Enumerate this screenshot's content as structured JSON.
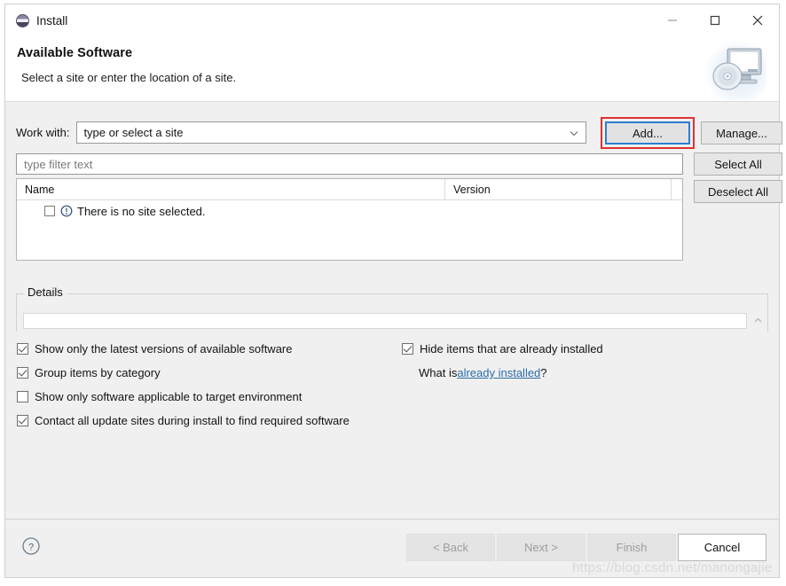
{
  "window": {
    "title": "Install",
    "app_icon": "eclipse-install-icon",
    "controls": {
      "minimize": "minimize-icon",
      "maximize": "maximize-icon",
      "close": "close-icon"
    }
  },
  "header": {
    "title": "Available Software",
    "subtitle": "Select a site or enter the location of a site.",
    "graphic": "computer-cd-icon"
  },
  "work_with": {
    "label": "Work with:",
    "value": "type or select a site",
    "dropdown_icon": "chevron-down-icon",
    "add_button": "Add...",
    "manage_button": "Manage...",
    "highlight_color": "#e03131",
    "focus_color": "#2d7dd2"
  },
  "filter": {
    "placeholder": "type filter text",
    "value": ""
  },
  "table": {
    "columns": [
      "Name",
      "Version"
    ],
    "rows": [
      {
        "checked": false,
        "icon": "info-circle-icon",
        "name": "There is no site selected.",
        "version": ""
      }
    ],
    "select_all_button": "Select All",
    "deselect_all_button": "Deselect All"
  },
  "details": {
    "label": "Details",
    "content": "",
    "collapse_icon": "chevron-up-icon"
  },
  "options": {
    "left": [
      {
        "label": "Show only the latest versions of available software",
        "checked": true
      },
      {
        "label": "Group items by category",
        "checked": true
      },
      {
        "label": "Show only software applicable to target environment",
        "checked": false
      },
      {
        "label": "Contact all update sites during install to find required software",
        "checked": true
      }
    ],
    "right": [
      {
        "label": "Hide items that are already installed",
        "checked": true
      }
    ],
    "what_is_prefix": "What is ",
    "what_is_link": "already installed",
    "what_is_suffix": "?"
  },
  "footer": {
    "help_icon": "help-circle-icon",
    "buttons": [
      {
        "label": "< Back",
        "enabled": false
      },
      {
        "label": "Next >",
        "enabled": false
      },
      {
        "label": "Finish",
        "enabled": false
      },
      {
        "label": "Cancel",
        "enabled": true
      }
    ]
  },
  "watermark": "https://blog.csdn.net/manongajie"
}
